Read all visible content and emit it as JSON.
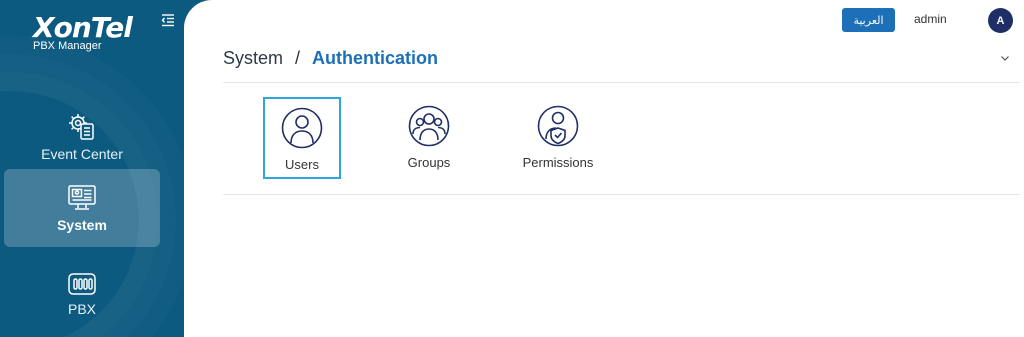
{
  "sidebar": {
    "logo": {
      "brand": "XonTel",
      "subtitle": "PBX Manager"
    },
    "items": [
      {
        "label": "Event Center",
        "icon": "event-center-gear-icon"
      },
      {
        "label": "System",
        "icon": "system-monitor-icon",
        "active": true
      },
      {
        "label": "PBX",
        "icon": "pbx-device-icon"
      }
    ]
  },
  "header": {
    "language_button": "العربية",
    "username": "admin",
    "avatar_initial": "A"
  },
  "breadcrumb": {
    "parent": "System",
    "separator": "/",
    "current": "Authentication"
  },
  "tiles": [
    {
      "label": "Users",
      "icon": "user-icon",
      "selected": true
    },
    {
      "label": "Groups",
      "icon": "group-icon"
    },
    {
      "label": "Permissions",
      "icon": "user-shield-icon"
    }
  ],
  "colors": {
    "sidebar": "#0d5a80",
    "accent": "#1d70b7",
    "icon": "#1f2e66",
    "selected_border": "#2ea7d6"
  }
}
